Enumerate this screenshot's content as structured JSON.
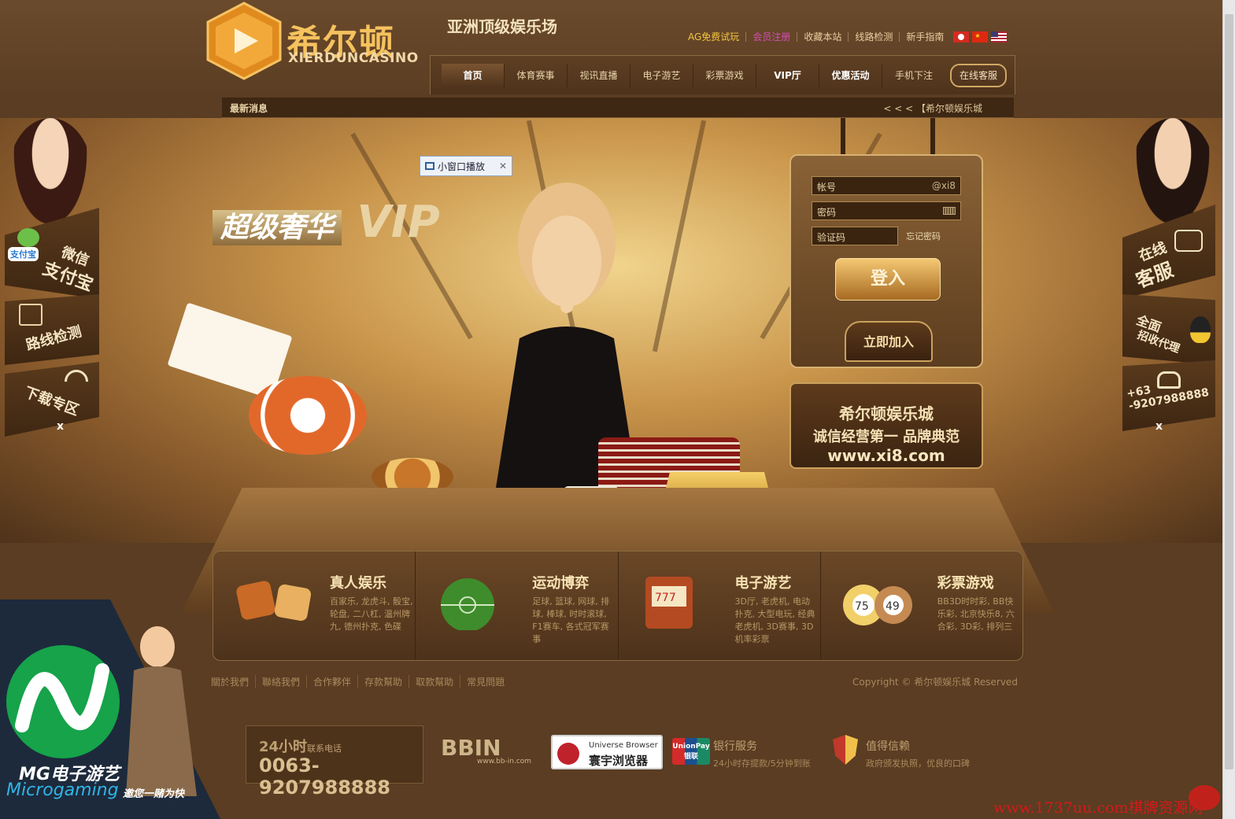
{
  "brand": {
    "name_cn": "希尔顿",
    "name_en": "XIERDUNCASINO",
    "slogan": "亚洲顶级娱乐场"
  },
  "top_links": [
    {
      "label": "AG免费试玩",
      "style": "yellow"
    },
    {
      "label": "会员注册",
      "style": "pink"
    },
    {
      "label": "收藏本站",
      "style": "normal"
    },
    {
      "label": "线路检测",
      "style": "normal"
    },
    {
      "label": "新手指南",
      "style": "normal"
    }
  ],
  "nav": {
    "items": [
      "首页",
      "体育赛事",
      "视讯直播",
      "电子游艺",
      "彩票游戏",
      "VIP厅",
      "优惠活动",
      "手机下注"
    ],
    "active_index": 0,
    "customer_service": "在线客服"
  },
  "news": {
    "label": "最新消息",
    "message": "< < <  【希尔顿娱乐城"
  },
  "banner": {
    "vip_cn": "超级奢华",
    "vip_en": "VIP"
  },
  "popup": {
    "label": "小窗口播放",
    "close": "✕"
  },
  "login": {
    "account_placeholder": "帐号",
    "account_suffix": "@xi8",
    "password_placeholder": "密码",
    "captcha_placeholder": "验证码",
    "forgot": "忘记密码",
    "login_btn": "登入",
    "join_btn": "立即加入"
  },
  "sign": {
    "line1": "希尔顿娱乐城",
    "line2": "诚信经营第一 品牌典范",
    "line3": "www.xi8.com"
  },
  "left_sidebar": {
    "pay1": "微信",
    "pay2": "支付宝",
    "pay_logo": "支付宝",
    "route": "路线检测",
    "download": "下载专区",
    "close": "x"
  },
  "right_sidebar": {
    "cs1": "在线",
    "cs2": "客服",
    "agent1": "全面",
    "agent2": "招收代理",
    "phone": "+63\n-9207988888",
    "close": "x"
  },
  "categories": [
    {
      "title": "真人娱乐",
      "desc": "百家乐, 龙虎斗, 骰宝, 轮盘, 二八杠, 温州牌九, 德州扑克, 色碟"
    },
    {
      "title": "运动博弈",
      "desc": "足球, 篮球, 网球, 排球, 棒球, 时时滚球, F1赛车, 各式冠军赛事"
    },
    {
      "title": "电子游艺",
      "desc": "3D厅, 老虎机, 电动扑克, 大型电玩, 经典老虎机, 3D赛事, 3D机率彩票"
    },
    {
      "title": "彩票游戏",
      "desc": "BB3D时时彩, BB快乐彩, 北京快乐8, 六合彩, 3D彩, 排列三"
    }
  ],
  "footer": {
    "links": [
      "關於我們",
      "聯絡我們",
      "合作夥伴",
      "存款幫助",
      "取款幫助",
      "常見問題"
    ],
    "copyright": "Copyright © 希尔顿娱乐城 Reserved",
    "hotline_title": "24小时",
    "hotline_sub": "联系电话",
    "hotline_number": "0063-9207988888",
    "bbin": "BBIN",
    "bbin_url": "www.bb-in.com",
    "browser_en": "Universe Browser",
    "browser_cn": "寰宇浏览器",
    "unionpay": "UnionPay 银联",
    "bank_title": "银行服务",
    "bank_desc": "24小时存提款/5分钟到账",
    "trust_title": "值得信赖",
    "trust_desc": "政府颁发执照，优良的口碑"
  },
  "mg": {
    "title": "MG电子游艺",
    "brand": "Microgaming",
    "tagline": "邀您一赌为快"
  },
  "watermark": "www.1737uu.com棋牌资源网",
  "colors": {
    "gold": "#f5c25e",
    "brown_dark": "#3e2713",
    "accent_pink": "#d24fb0",
    "watermark_red": "#d41a1a"
  }
}
